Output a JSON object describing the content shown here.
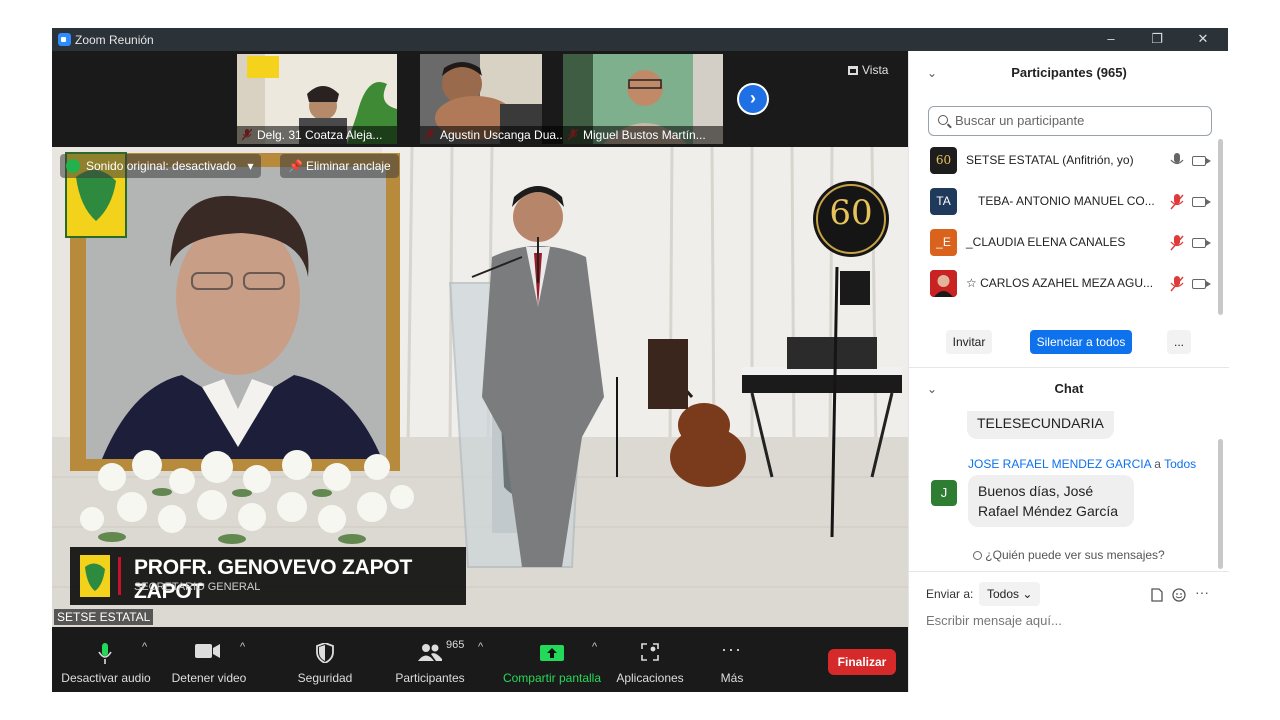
{
  "window": {
    "title": "Zoom Reunión",
    "controls": [
      "–",
      "❐",
      "✕"
    ]
  },
  "thumbnails": [
    {
      "label": "Delg. 31 Coatza Aleja..."
    },
    {
      "label": "Agustin Uscanga Dua..."
    },
    {
      "label": "Miguel Bustos Martín..."
    }
  ],
  "view_label": "Vista",
  "main_video": {
    "original_sound": "Sonido original: desactivado",
    "unpin": "Eliminar anclaje",
    "lower_third_name": "PROFR. GENOVEVO ZAPOT ZAPOT",
    "lower_third_role": "SECRETARIO GENERAL",
    "speaker_tag": "SETSE ESTATAL",
    "anniversary": "60"
  },
  "toolbar": {
    "audio": "Desactivar audio",
    "video": "Detener video",
    "security": "Seguridad",
    "participants": "Participantes",
    "participants_count": "965",
    "share": "Compartir pantalla",
    "apps": "Aplicaciones",
    "more": "Más",
    "end": "Finalizar"
  },
  "participants_panel": {
    "header": "Participantes (965)",
    "search_placeholder": "Buscar un participante",
    "rows": [
      {
        "avatar": "60",
        "name": "SETSE ESTATAL (Anfitrión, yo)",
        "avatar_color": "#1d1d1d"
      },
      {
        "avatar": "TA",
        "name": "TEBA- ANTONIO MANUEL CO...",
        "avatar_color": "#1f3a5a"
      },
      {
        "avatar": "_E",
        "name": "_CLAUDIA ELENA CANALES",
        "avatar_color": "#d9621c"
      },
      {
        "avatar": "",
        "name": "☆ CARLOS AZAHEL MEZA AGU...",
        "avatar_color": "#3a2a2a"
      }
    ],
    "invite": "Invitar",
    "mute_all": "Silenciar a todos",
    "more": "..."
  },
  "chat_panel": {
    "header": "Chat",
    "messages": [
      {
        "text": "TELESECUNDARIA"
      },
      {
        "sender": "JOSE RAFAEL MENDEZ GARCIA",
        "to_word": "a",
        "to": "Todos",
        "avatar": "J",
        "line1": "Buenos días, José",
        "line2": "Rafael Méndez García"
      }
    ],
    "who_can_see": "¿Quién puede ver sus mensajes?",
    "send_to_label": "Enviar a:",
    "send_to_value": "Todos",
    "input_placeholder": "Escribir mensaje aquí..."
  },
  "colors": {
    "accent": "#0e72ed",
    "end": "#d62a2a",
    "share": "#23d959",
    "toolbar_bg": "#1a1a1a"
  }
}
